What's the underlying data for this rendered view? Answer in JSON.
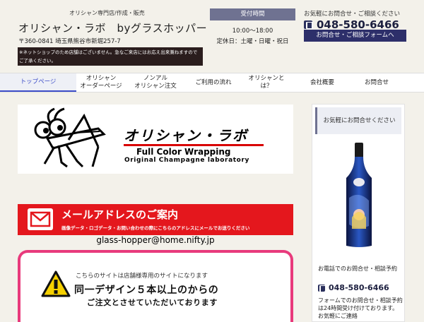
{
  "header": {
    "tagline": "オリシャン専門店/作成・販売",
    "site_title": "オリシャン・ラボ　byグラスホッパー",
    "address": "〒360-0841 埼玉県熊谷市新堀257-7",
    "notice_text": "※ネットショップのため店舗はございません。急なご来店にはお応え出来兼ねますのでご了承ください。"
  },
  "hours": {
    "label": "受付時間",
    "time": "10:00～18:00",
    "closed": "定休日：土曜・日曜・祝日"
  },
  "contact": {
    "invite": "お気軽にお問合せ・ご相談ください",
    "tel": "048-580-6466",
    "form_button": "お問合せ・ご相談フォームへ"
  },
  "nav": {
    "items": [
      {
        "label": "トップページ",
        "active": true
      },
      {
        "label": "オリシャン\nオーダーページ"
      },
      {
        "label": "ノンアル\nオリシャン注文"
      },
      {
        "label": "ご利用の流れ"
      },
      {
        "label": "オリシャンとは？"
      },
      {
        "label": "会社概要"
      },
      {
        "label": "お問合せ"
      }
    ]
  },
  "main": {
    "logo": {
      "title": "オリシャン・ラボ",
      "sub1": "Full Color Wrapping",
      "sub2": "Original Champagne laboratory"
    },
    "mail_banner": {
      "heading": "メールアドレスのご案内",
      "desc": "画像データ・ロゴデータ・お問い合わせの際にこちらのアドレスにメールでお送りください"
    },
    "email": "glass-hopper@home.nifty.jp",
    "notice": {
      "line1": "こちらのサイトは店舗様専用のサイトになります",
      "line2": "同一デザイン５本以上のからの",
      "line3": "ご注文とさせていただいております"
    }
  },
  "sidebar": {
    "header": "お気軽にお問合せください",
    "phone_label": "お電話でのお問合せ・相談予約",
    "tel": "048-580-6466",
    "desc": "フォームでのお問合せ・相談予約は24時間受け付けております。お気軽にご連絡"
  },
  "colors": {
    "accent_navy": "#2d2f6a",
    "nav_active": "#3d4dc8",
    "mail_red": "#e4171d",
    "notice_pink": "#e83a7c"
  }
}
